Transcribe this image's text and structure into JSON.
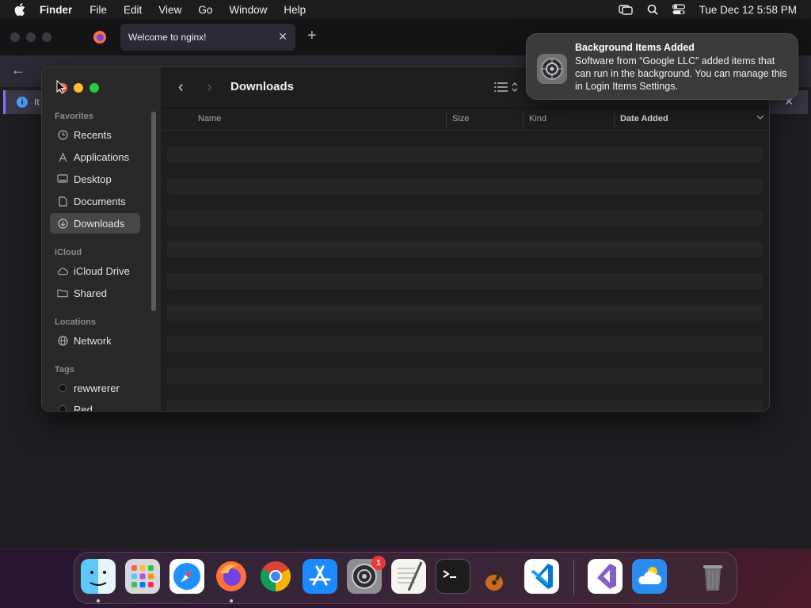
{
  "menubar": {
    "app": "Finder",
    "items": [
      "File",
      "Edit",
      "View",
      "Go",
      "Window",
      "Help"
    ],
    "clock": "Tue Dec 12  5:58 PM"
  },
  "browser": {
    "tab_title": "Welcome to nginx!",
    "tab_close": "✕",
    "new_tab": "+",
    "back": "←",
    "info_text": "It",
    "info_close": "✕"
  },
  "finder": {
    "title": "Downloads",
    "nav_back": "‹",
    "nav_forward": "›",
    "sidebar": {
      "favorites_label": "Favorites",
      "favorites": [
        "Recents",
        "Applications",
        "Desktop",
        "Documents",
        "Downloads"
      ],
      "icloud_label": "iCloud",
      "icloud": [
        "iCloud Drive",
        "Shared"
      ],
      "locations_label": "Locations",
      "locations": [
        "Network"
      ],
      "tags_label": "Tags",
      "tags": [
        "rewwrerer",
        "Red"
      ]
    },
    "columns": {
      "name": "Name",
      "size": "Size",
      "kind": "Kind",
      "date_added": "Date Added"
    }
  },
  "notification": {
    "title": "Background Items Added",
    "body": "Software from “Google LLC” added items that can run in the background. You can manage this in Login Items Settings."
  },
  "dock": {
    "settings_badge": "1"
  },
  "colors": {
    "accent_active_sidebar": "#464646",
    "traffic_close": "#ff5f57",
    "traffic_min": "#febc2e",
    "traffic_max": "#28c840"
  }
}
